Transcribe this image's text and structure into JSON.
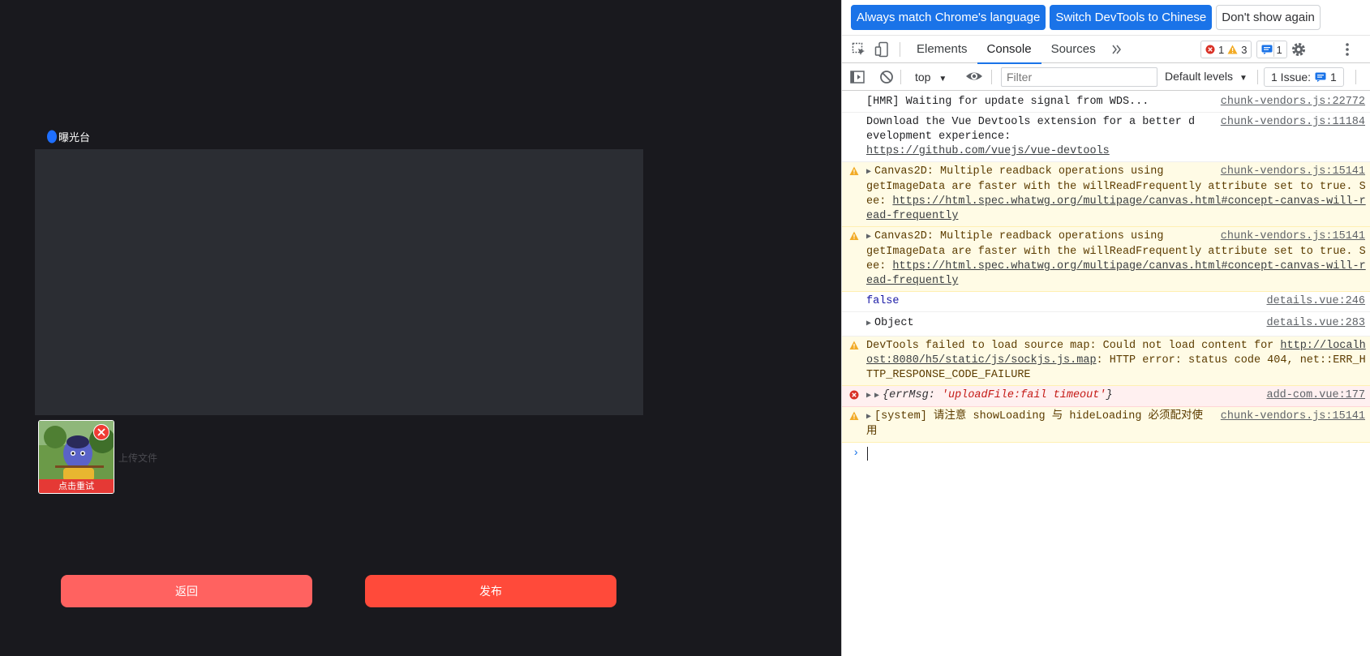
{
  "app": {
    "section_label": "曝光台",
    "upload_hint": "上传文件",
    "retry_label": "点击重试",
    "back_button": "返回",
    "publish_button": "发布"
  },
  "devtools": {
    "lang_bar": {
      "match_language": "Always match Chrome's language",
      "switch_chinese": "Switch DevTools to Chinese",
      "dont_show": "Don't show again"
    },
    "tabs": [
      "Elements",
      "Console",
      "Sources"
    ],
    "active_tab": "Console",
    "error_count": "1",
    "warning_count": "3",
    "info_count": "1",
    "toolbar": {
      "context": "top",
      "filter_placeholder": "Filter",
      "levels": "Default levels",
      "issues_label": "1 Issue:",
      "issues_count": "1"
    },
    "messages": [
      {
        "text": "[HMR] Waiting for update signal from WDS...",
        "source": "chunk-vendors.js:22772"
      },
      {
        "text": "Download the Vue Devtools extension for a better development experience:",
        "link": "https://github.com/vuejs/vue-devtools",
        "source": "chunk-vendors.js:11184"
      },
      {
        "text_a": "Canvas2D: Multiple readback operations using",
        "text_b": "getImageData are faster with the willReadFrequently attribute set to true. See: ",
        "link": "https://html.spec.whatwg.org/multipage/canvas.html#concept-canvas-will-read-frequently",
        "source": "chunk-vendors.js:15141"
      },
      {
        "text_a": "Canvas2D: Multiple readback operations using",
        "text_b": "getImageData are faster with the willReadFrequently attribute set to true. See: ",
        "link": "https://html.spec.whatwg.org/multipage/canvas.html#concept-canvas-will-read-frequently",
        "source": "chunk-vendors.js:15141"
      },
      {
        "text": "false",
        "source": "details.vue:246"
      },
      {
        "text": "Object",
        "source": "details.vue:283"
      },
      {
        "text_a": "DevTools failed to load source map: Could not load content for ",
        "link": "http://localhost:8080/h5/static/js/sockjs.js.map",
        "text_b": ": HTTP error: status code 404, net::ERR_HTTP_RESPONSE_CODE_FAILURE"
      },
      {
        "key": "errMsg",
        "value": "'uploadFile:fail timeout'",
        "source": "add-com.vue:177"
      },
      {
        "text": "[system] 请注意 showLoading 与 hideLoading 必须配对使用",
        "source": "chunk-vendors.js:15141"
      }
    ]
  },
  "colors": {
    "app_bg": "#19191e",
    "textarea_bg": "#2b2d33",
    "back_button": "#ff6260",
    "publish_button": "#ff4a3a",
    "devtools_accent": "#1a73e8",
    "warning_bg": "#fffbe5",
    "error_bg": "#fff0f0"
  }
}
